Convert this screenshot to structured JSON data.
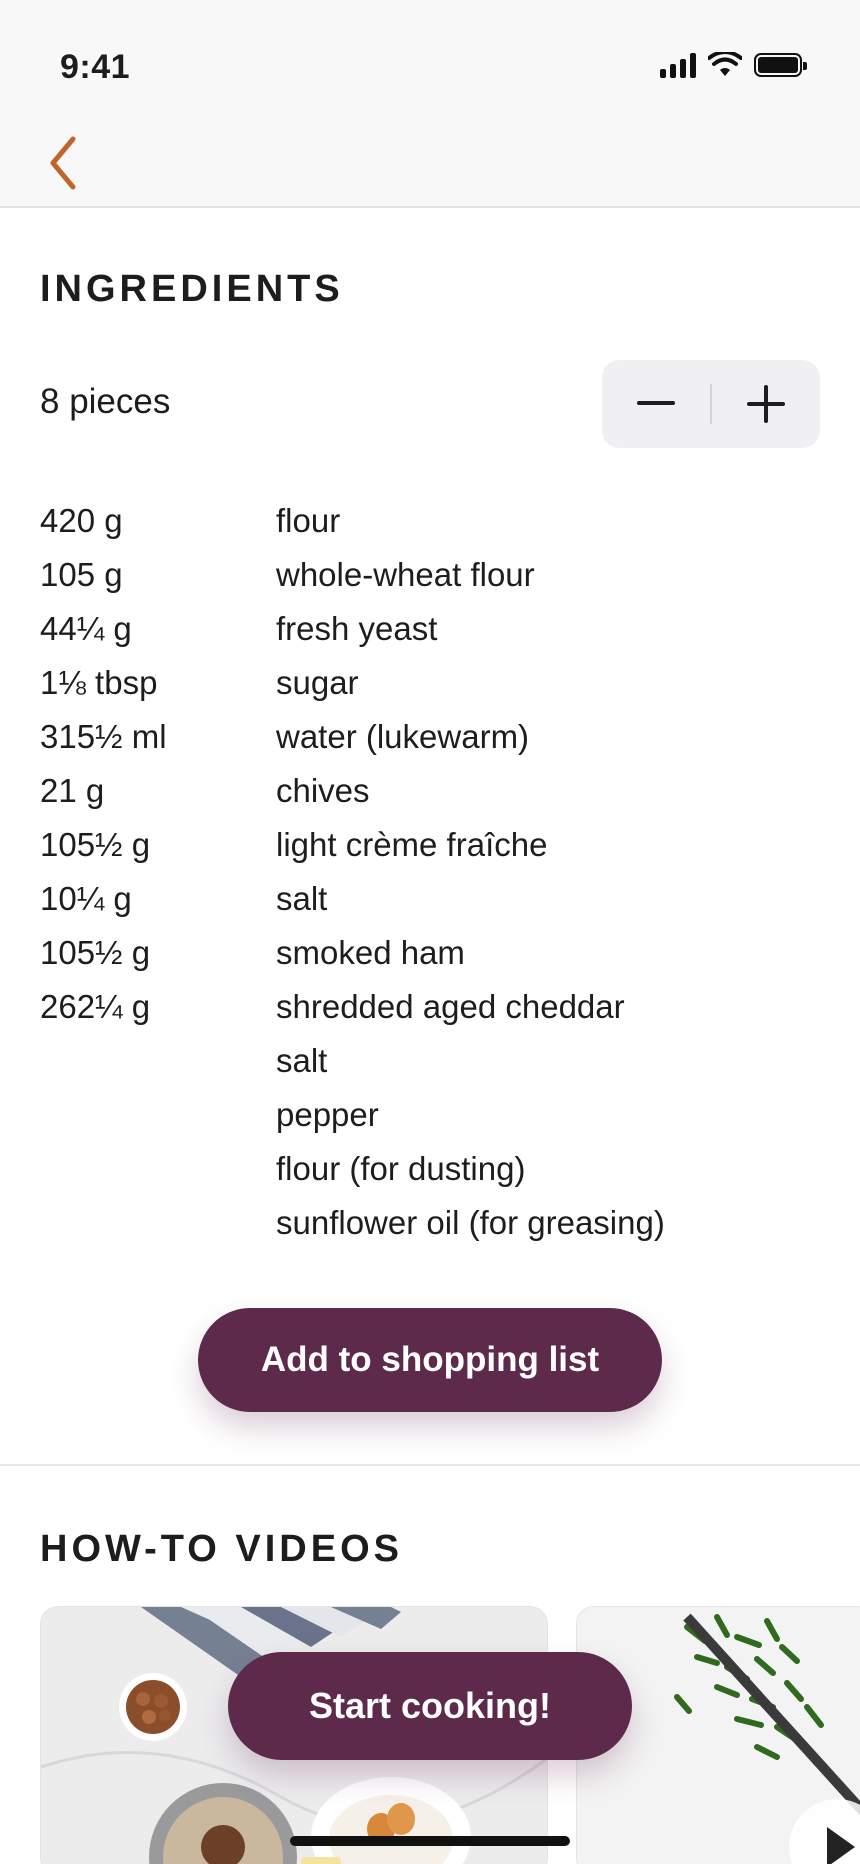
{
  "status_bar": {
    "time": "9:41"
  },
  "nav": {
    "back_icon": "chevron-left-icon",
    "accent_color": "#c0652a"
  },
  "ingredients_section": {
    "title": "INGREDIENTS",
    "servings": "8 pieces",
    "stepper": {
      "decrease_icon": "minus-icon",
      "increase_icon": "plus-icon"
    },
    "items": [
      {
        "qty": "420 g",
        "name": "flour"
      },
      {
        "qty": "105 g",
        "name": "whole-wheat flour"
      },
      {
        "qty": "44¼ g",
        "name": "fresh yeast"
      },
      {
        "qty": "1⅛ tbsp",
        "name": "sugar"
      },
      {
        "qty": "315½ ml",
        "name": "water (lukewarm)"
      },
      {
        "qty": "21 g",
        "name": "chives"
      },
      {
        "qty": "105½ g",
        "name": "light crème fraîche"
      },
      {
        "qty": "10¼ g",
        "name": "salt"
      },
      {
        "qty": "105½ g",
        "name": "smoked ham"
      },
      {
        "qty": "262¼ g",
        "name": "shredded aged cheddar"
      },
      {
        "qty": "",
        "name": "salt"
      },
      {
        "qty": "",
        "name": "pepper"
      },
      {
        "qty": "",
        "name": "flour (for dusting)"
      },
      {
        "qty": "",
        "name": "sunflower oil (for greasing)"
      }
    ],
    "add_button": "Add to shopping list"
  },
  "videos_section": {
    "title": "HOW-TO VIDEOS",
    "start_button": "Start cooking!"
  },
  "colors": {
    "primary": "#5e2a4c",
    "background": "#ffffff",
    "bar_background": "#f8f8f8"
  }
}
